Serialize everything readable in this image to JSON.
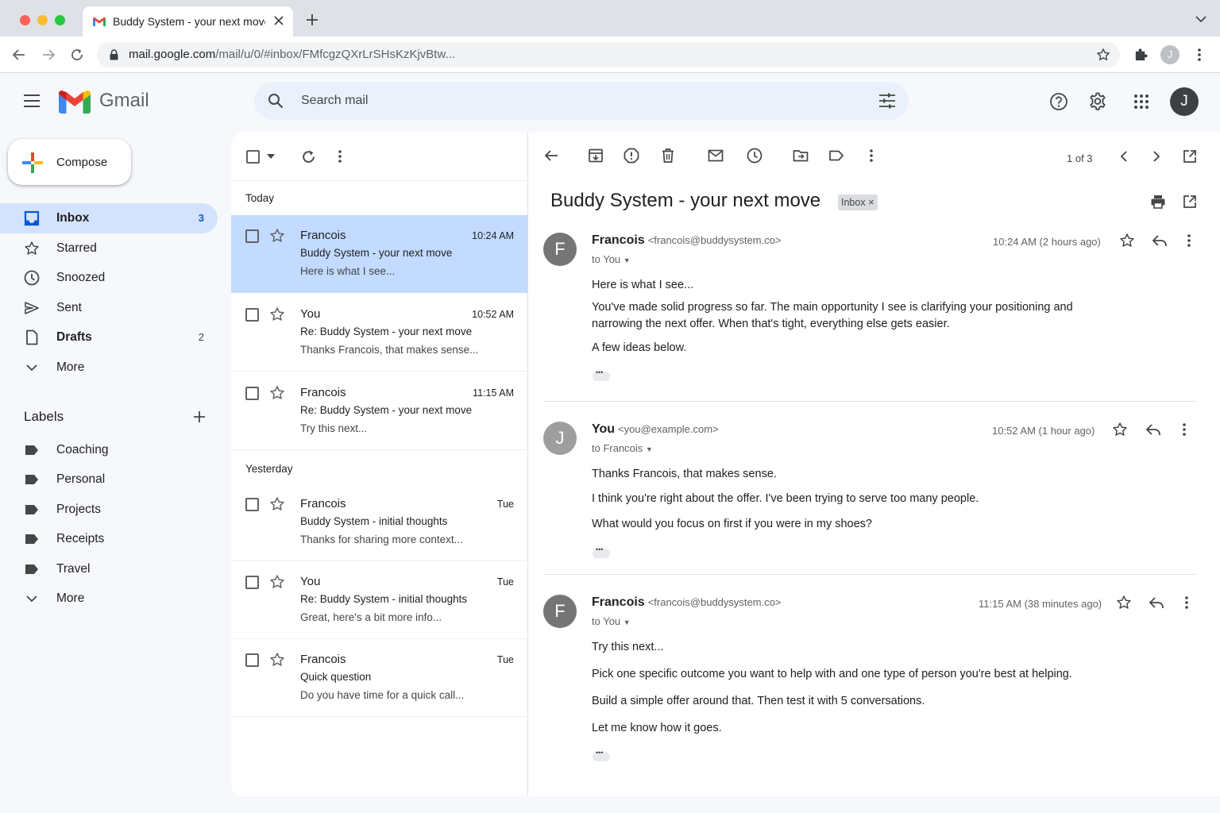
{
  "browser": {
    "tab_title": "Buddy System - your next move",
    "url_host": "mail.google.com",
    "url_rest": "/mail/u/0/#inbox/FMfcgzQXrLrSHsKzKjvBtw...",
    "profile_initial": "J"
  },
  "header": {
    "app_name": "Gmail",
    "search_placeholder": "Search mail",
    "avatar_initial": "J"
  },
  "sidebar": {
    "compose_label": "Compose",
    "items": [
      {
        "label": "Inbox",
        "count": "3",
        "icon": "inbox-icon"
      },
      {
        "label": "Starred",
        "count": "",
        "icon": "star-icon"
      },
      {
        "label": "Snoozed",
        "count": "",
        "icon": "clock-icon"
      },
      {
        "label": "Sent",
        "count": "",
        "icon": "send-icon"
      },
      {
        "label": "Drafts",
        "count": "2",
        "icon": "draft-icon"
      },
      {
        "label": "More",
        "count": "",
        "icon": "chevron-down-icon"
      }
    ],
    "labels_heading": "Labels",
    "labels": [
      "Coaching",
      "Personal",
      "Projects",
      "Receipts",
      "Travel"
    ],
    "labels_more": "More"
  },
  "list": {
    "today_header": "Today",
    "yesterday_header": "Yesterday",
    "messages": [
      {
        "sender": "Francois",
        "time": "10:24 AM",
        "subject": "Buddy System - your next move",
        "snippet": "Here is what I see..."
      },
      {
        "sender": "You",
        "time": "10:52 AM",
        "subject": "Re: Buddy System - your next move",
        "snippet": "Thanks Francois, that makes sense..."
      },
      {
        "sender": "Francois",
        "time": "11:15 AM",
        "subject": "Re: Buddy System - your next move",
        "snippet": "Try this next..."
      },
      {
        "sender": "Francois",
        "time": "Tue",
        "subject": "Buddy System - initial thoughts",
        "snippet": "Thanks for sharing more context..."
      },
      {
        "sender": "You",
        "time": "Tue",
        "subject": "Re: Buddy System - initial thoughts",
        "snippet": "Great, here's a bit more info..."
      },
      {
        "sender": "Francois",
        "time": "Tue",
        "subject": "Quick question",
        "snippet": "Do you have time for a quick call..."
      }
    ]
  },
  "reader": {
    "pager": "1 of 3",
    "subject": "Buddy System - your next move",
    "chip": "Inbox",
    "thread": [
      {
        "initial": "F",
        "name": "Francois",
        "email": "<francois@buddysystem.co>",
        "to": "to You",
        "time": "10:24 AM (2 hours ago)",
        "body": [
          "Here is what I see...",
          "You've made solid progress so far. The main opportunity I see is clarifying your positioning and narrowing the next offer. When that's tight, everything else gets easier.",
          "A few ideas below."
        ]
      },
      {
        "initial": "J",
        "name": "You",
        "email": "<you@example.com>",
        "to": "to Francois",
        "time": "10:52 AM (1 hour ago)",
        "body": [
          "Thanks Francois, that makes sense.",
          "I think you're right about the offer. I've been trying to serve too many people.",
          "What would you focus on first if you were in my shoes?"
        ]
      },
      {
        "initial": "F",
        "name": "Francois",
        "email": "<francois@buddysystem.co>",
        "to": "to You",
        "time": "11:15 AM (38 minutes ago)",
        "body": [
          "Try this next...",
          "Pick one specific outcome you want to help with and one type of person you're best at helping.",
          "Build a simple offer around that. Then test it with 5 conversations.",
          "Let me know how it goes."
        ]
      }
    ]
  },
  "colors": {
    "background": "#f6f8fc",
    "active_nav": "#d3e3fd",
    "selected_row": "#c2dbff",
    "search_bg": "#eaf1fb"
  }
}
